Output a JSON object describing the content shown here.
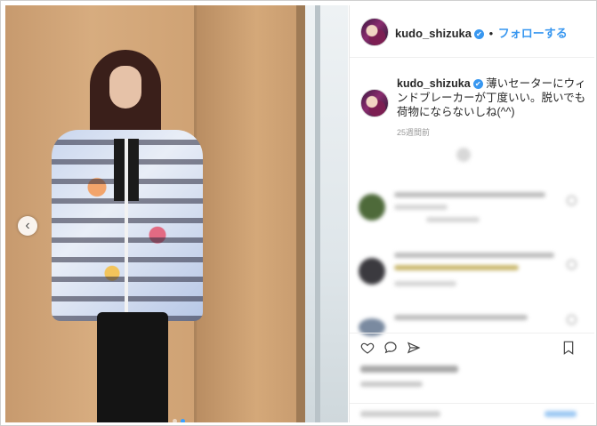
{
  "post": {
    "username": "kudo_shizuka",
    "verified_mark": "✔",
    "separator": "•",
    "follow_label": "フォローする",
    "caption_username": "kudo_shizuka",
    "caption": "薄いセーターにウィンドブレーカーが丁度いい。脱いでも荷物にならないしね(^^)",
    "timestamp": "25週間前",
    "prev_arrow": "‹"
  },
  "icons": {
    "like": "heart-icon",
    "comment": "comment-icon",
    "share": "share-icon",
    "save": "bookmark-icon"
  },
  "colors": {
    "link": "#3897f0",
    "text": "#262626",
    "muted": "#999999"
  }
}
